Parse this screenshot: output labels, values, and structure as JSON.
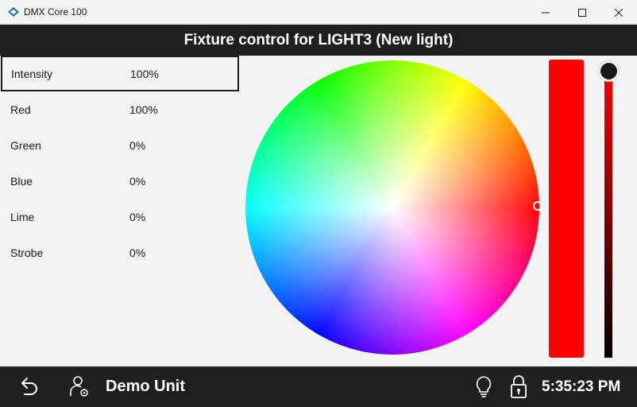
{
  "window": {
    "title": "DMX Core 100"
  },
  "header": {
    "title": "Fixture control for LIGHT3 (New light)"
  },
  "parameters": [
    {
      "name": "Intensity",
      "value": "100%"
    },
    {
      "name": "Red",
      "value": "100%"
    },
    {
      "name": "Green",
      "value": "0%"
    },
    {
      "name": "Blue",
      "value": "0%"
    },
    {
      "name": "Lime",
      "value": "0%"
    },
    {
      "name": "Strobe",
      "value": "0%"
    }
  ],
  "selected_parameter": "Intensity",
  "color_picker": {
    "current_color": "#ff0000",
    "intensity_level": 1.0
  },
  "footer": {
    "unit_name": "Demo Unit",
    "clock": "5:35:23 PM"
  },
  "icons": [
    "app-logo-icon",
    "minimize-icon",
    "maximize-icon",
    "close-icon",
    "back-icon",
    "user-settings-icon",
    "lightbulb-icon",
    "lock-icon"
  ]
}
